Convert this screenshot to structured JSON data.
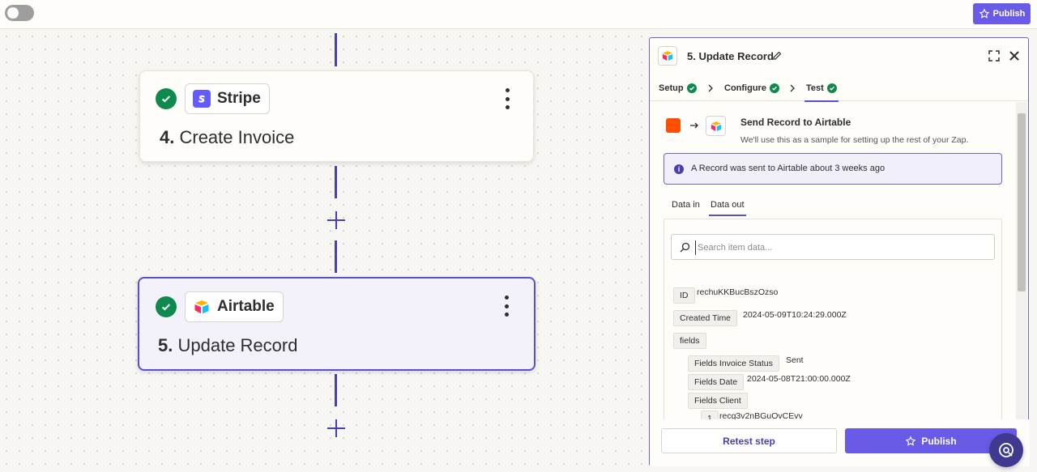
{
  "topbar": {
    "publish_label": "Publish"
  },
  "steps": [
    {
      "number": "4.",
      "title": "Create Invoice",
      "app": "Stripe",
      "status": "complete"
    },
    {
      "number": "5.",
      "title": "Update Record",
      "app": "Airtable",
      "status": "complete"
    }
  ],
  "panel": {
    "title": "5. Update Record",
    "tabs": [
      {
        "label": "Setup"
      },
      {
        "label": "Configure"
      },
      {
        "label": "Test"
      }
    ],
    "send": {
      "title": "Send Record to Airtable",
      "subtitle": "We'll use this as a sample for setting up the rest of your Zap."
    },
    "info": "A Record was sent to Airtable about 3 weeks ago",
    "data_tabs": [
      {
        "label": "Data in"
      },
      {
        "label": "Data out"
      }
    ],
    "search_placeholder": "Search item data...",
    "records": [
      {
        "key": "ID",
        "value": "rechuKKBucBszOzso"
      },
      {
        "key": "Created Time",
        "value": "2024-05-09T10:24:29.000Z"
      },
      {
        "key": "fields",
        "value": ""
      },
      {
        "key": "Fields Invoice Status",
        "value": "Sent"
      },
      {
        "key": "Fields Date",
        "value": "2024-05-08T21:00:00.000Z"
      },
      {
        "key": "Fields Client",
        "value": ""
      },
      {
        "key": "1",
        "value": "recg3v2nBGuOvCEvv"
      }
    ],
    "retest_label": "Retest step",
    "publish_label": "Publish"
  },
  "colors": {
    "accent": "#695be8",
    "success": "#0f8a4e",
    "connector": "#4a3fb2",
    "zapier_orange": "#ff4f00"
  }
}
